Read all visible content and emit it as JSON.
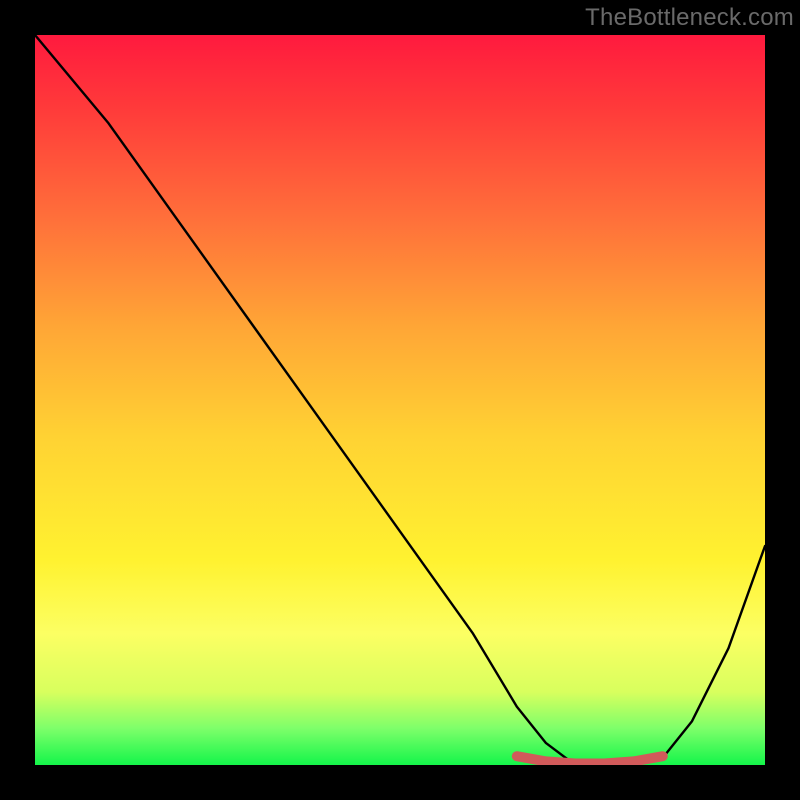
{
  "watermark": "TheBottleneck.com",
  "chart_data": {
    "type": "line",
    "title": "",
    "xlabel": "",
    "ylabel": "",
    "xlim": [
      0,
      100
    ],
    "ylim": [
      0,
      100
    ],
    "series": [
      {
        "name": "bottleneck-curve",
        "x": [
          0,
          10,
          20,
          30,
          40,
          50,
          60,
          66,
          70,
          74,
          78,
          82,
          86,
          90,
          95,
          100
        ],
        "values": [
          100,
          88,
          74,
          60,
          46,
          32,
          18,
          8,
          3,
          0,
          0,
          0,
          1,
          6,
          16,
          30
        ],
        "color": "#000000"
      },
      {
        "name": "optimal-segment",
        "x": [
          66,
          70,
          74,
          78,
          82,
          86
        ],
        "values": [
          1.2,
          0.5,
          0.2,
          0.2,
          0.5,
          1.2
        ],
        "color": "#d15a5a"
      }
    ],
    "gradient_stops": [
      {
        "pos": 0,
        "color": "#ff1a3e"
      },
      {
        "pos": 10,
        "color": "#ff3a3a"
      },
      {
        "pos": 25,
        "color": "#ff6f3a"
      },
      {
        "pos": 40,
        "color": "#ffa636"
      },
      {
        "pos": 55,
        "color": "#ffd233"
      },
      {
        "pos": 72,
        "color": "#fff230"
      },
      {
        "pos": 82,
        "color": "#fcff63"
      },
      {
        "pos": 90,
        "color": "#d8ff5e"
      },
      {
        "pos": 95,
        "color": "#7dff6a"
      },
      {
        "pos": 100,
        "color": "#14f54a"
      }
    ]
  }
}
